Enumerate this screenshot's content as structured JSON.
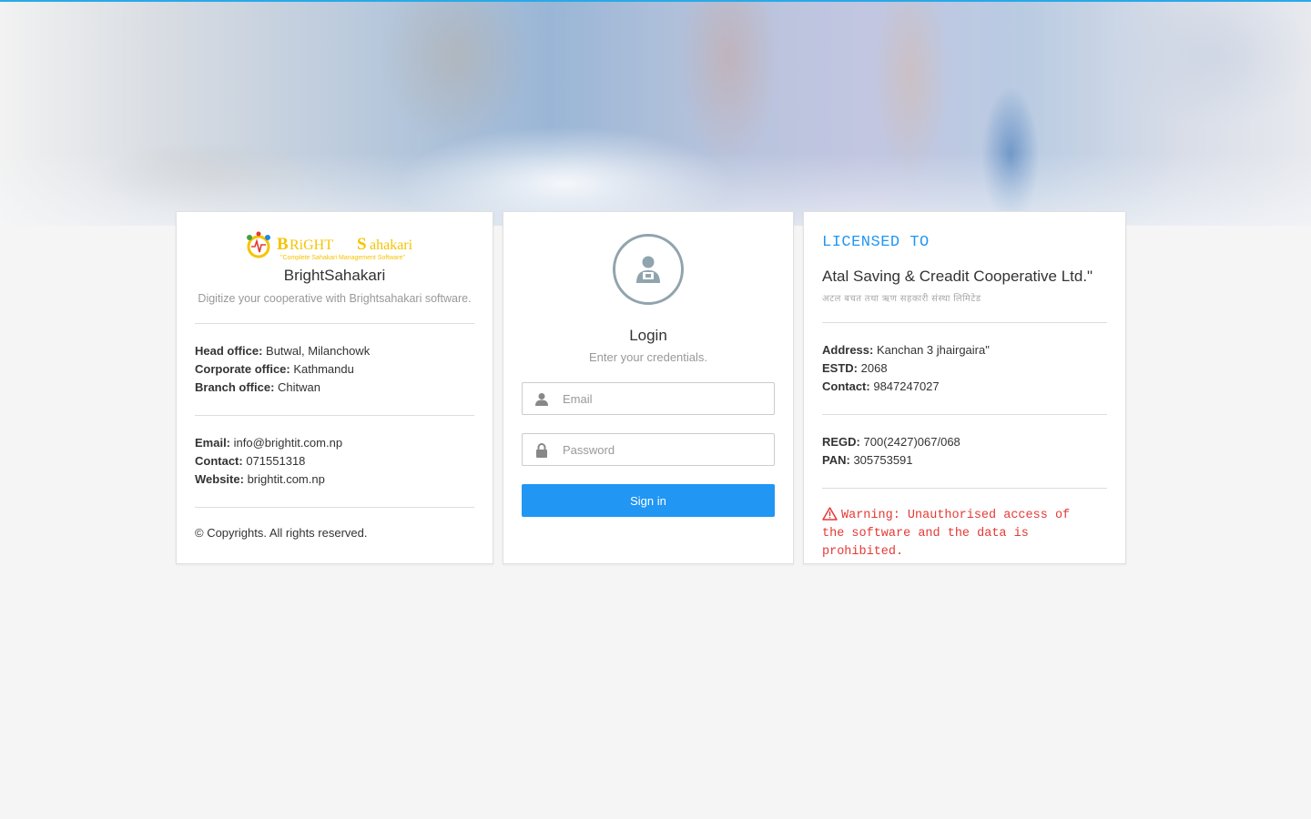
{
  "brand": {
    "logo_text_main": "BRIGHT Sahakari",
    "logo_tagline": "\"Complete Sahakari Management Software\"",
    "name": "BrightSahakari",
    "tagline": "Digitize your cooperative with Brightsahakari software."
  },
  "offices": [
    {
      "label": "Head office:",
      "value": "Butwal, Milanchowk"
    },
    {
      "label": "Corporate office:",
      "value": "Kathmandu"
    },
    {
      "label": "Branch office:",
      "value": "Chitwan"
    }
  ],
  "contact": [
    {
      "label": "Email:",
      "value": "info@brightit.com.np"
    },
    {
      "label": "Contact:",
      "value": "071551318"
    },
    {
      "label": "Website:",
      "value": "brightit.com.np"
    }
  ],
  "copyright": "© Copyrights. All rights reserved.",
  "login": {
    "title": "Login",
    "subtitle": "Enter your credentials.",
    "email_placeholder": "Email",
    "password_placeholder": "Password",
    "signin_label": "Sign in"
  },
  "license": {
    "heading": "LICENSED TO",
    "org_name": "Atal Saving & Creadit Cooperative Ltd.\"",
    "org_name_np": "अटल बचत तथा ऋण सहकारी संस्था लिमिटेड",
    "details": [
      {
        "label": "Address:",
        "value": "Kanchan 3 jhairgaira\""
      },
      {
        "label": "ESTD:",
        "value": "2068"
      },
      {
        "label": "Contact:",
        "value": "9847247027"
      }
    ],
    "registration": [
      {
        "label": "REGD:",
        "value": "700(2427)067/068"
      },
      {
        "label": "PAN:",
        "value": "305753591"
      }
    ],
    "warning_line1": "Warning: Unauthorised access of",
    "warning_line2": "the software and the data is prohibited."
  },
  "colors": {
    "accent": "#2196f3",
    "warning": "#e53935",
    "top_line": "#29a9e8"
  }
}
